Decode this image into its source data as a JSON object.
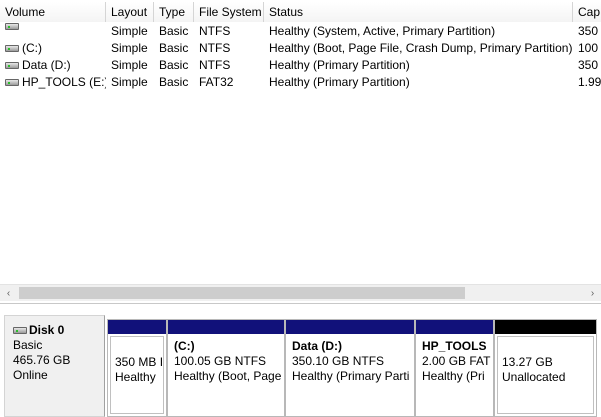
{
  "columns": [
    {
      "key": "volume",
      "label": "Volume"
    },
    {
      "key": "layout",
      "label": "Layout"
    },
    {
      "key": "type",
      "label": "Type"
    },
    {
      "key": "fs",
      "label": "File System"
    },
    {
      "key": "status",
      "label": "Status"
    },
    {
      "key": "cap",
      "label": "Cap"
    }
  ],
  "volumes": [
    {
      "volume": "",
      "layout": "Simple",
      "type": "Basic",
      "fs": "NTFS",
      "status": "Healthy (System, Active, Primary Partition)",
      "cap": "350"
    },
    {
      "volume": "(C:)",
      "layout": "Simple",
      "type": "Basic",
      "fs": "NTFS",
      "status": "Healthy (Boot, Page File, Crash Dump, Primary Partition)",
      "cap": "100"
    },
    {
      "volume": "Data (D:)",
      "layout": "Simple",
      "type": "Basic",
      "fs": "NTFS",
      "status": "Healthy (Primary Partition)",
      "cap": "350"
    },
    {
      "volume": "HP_TOOLS (E:)",
      "layout": "Simple",
      "type": "Basic",
      "fs": "FAT32",
      "status": "Healthy (Primary Partition)",
      "cap": "1.99"
    }
  ],
  "scrollbar": {
    "left_arrow": "‹",
    "right_arrow": "›"
  },
  "disk": {
    "name": "Disk 0",
    "type": "Basic",
    "size": "465.76 GB",
    "status": "Online"
  },
  "partitions": [
    {
      "title": "",
      "size_line": "350 MB I",
      "status_line": "Healthy"
    },
    {
      "title": "(C:)",
      "size_line": "100.05 GB NTFS",
      "status_line": "Healthy (Boot, Page"
    },
    {
      "title": "Data  (D:)",
      "size_line": "350.10 GB NTFS",
      "status_line": "Healthy (Primary Parti"
    },
    {
      "title": "HP_TOOLS",
      "size_line": "2.00 GB FAT",
      "status_line": "Healthy (Pri"
    },
    {
      "title": "",
      "size_line": "13.27 GB",
      "status_line": "Unallocated"
    }
  ],
  "colors": {
    "primary_partition": "#11117a",
    "unallocated": "#000000"
  },
  "icons": {
    "volume": "drive-icon",
    "disk": "disk-icon"
  }
}
